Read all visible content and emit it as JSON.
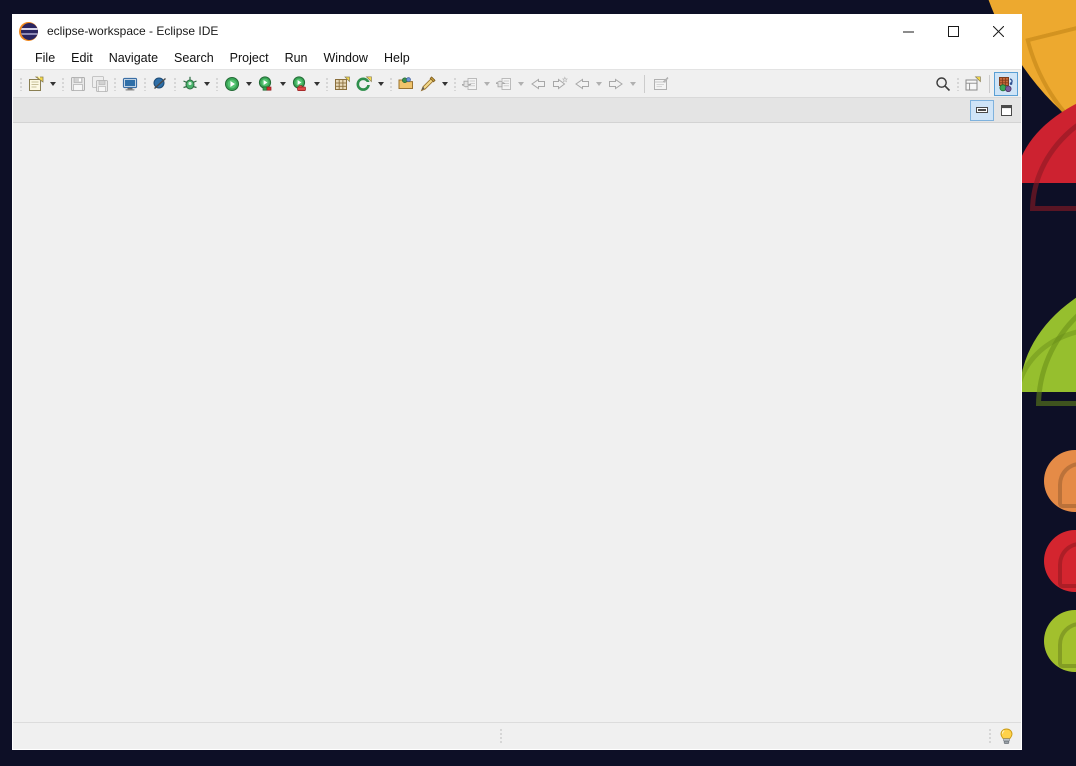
{
  "desktop": {
    "name": "desktop-wallpaper",
    "background_color": "#0d0f26",
    "shapes": [
      {
        "name": "petal-orange",
        "color": "#eda92f"
      },
      {
        "name": "petal-red",
        "color": "#cd2230"
      },
      {
        "name": "petal-green",
        "color": "#96bf2e"
      },
      {
        "name": "badge-orange",
        "color": "#e58b47"
      },
      {
        "name": "badge-red",
        "color": "#d4252f"
      },
      {
        "name": "badge-green",
        "color": "#a2c02d"
      }
    ]
  },
  "window": {
    "title": "eclipse-workspace - Eclipse IDE",
    "app_icon": "eclipse-logo-icon",
    "controls": [
      {
        "name": "minimize",
        "icon": "minimize-icon"
      },
      {
        "name": "maximize",
        "icon": "maximize-icon"
      },
      {
        "name": "close",
        "icon": "close-icon"
      }
    ]
  },
  "menubar": {
    "items": [
      {
        "label": "File"
      },
      {
        "label": "Edit"
      },
      {
        "label": "Navigate"
      },
      {
        "label": "Search"
      },
      {
        "label": "Project"
      },
      {
        "label": "Run"
      },
      {
        "label": "Window"
      },
      {
        "label": "Help"
      }
    ]
  },
  "toolbar": {
    "new_label": "New",
    "new_dropdown_label": "New menu",
    "save_label": "Save",
    "save_all_label": "Save All",
    "console_label": "Open Console",
    "skip_breakpoints_label": "Skip All Breakpoints",
    "debug_label": "Debug",
    "debug_dropdown_label": "Debug menu",
    "run_label": "Run",
    "run_dropdown_label": "Run menu",
    "coverage_label": "Coverage",
    "coverage_dropdown_label": "Coverage menu",
    "profile_label": "Profile",
    "profile_dropdown_label": "Profile menu",
    "new_package_label": "New Java Package",
    "new_class_label": "New Java Class",
    "new_class_dropdown_label": "New Java Class menu",
    "open_type_label": "Open Type",
    "quickfix_label": "Toggle Mark Occurrences",
    "quickfix_dropdown_label": "Mark Occurrences menu",
    "next_annotation_label": "Next Annotation",
    "next_annotation_dropdown_label": "Next Annotation menu",
    "prev_annotation_label": "Previous Annotation",
    "prev_annotation_dropdown_label": "Previous Annotation menu",
    "last_edit_label": "Last Edit Location",
    "forward_edit_label": "Next Edit Location",
    "back_label": "Back",
    "back_dropdown_label": "Back history",
    "forward_label": "Forward",
    "forward_dropdown_label": "Forward history",
    "pin_editor_label": "Pin Editor",
    "search_label": "Search",
    "open_perspective_label": "Open Perspective",
    "java_perspective_label": "Java",
    "java_perspective_active": true,
    "accent_active_bg": "#cfe4f7",
    "accent_active_border": "#5a9fd4"
  },
  "editor": {
    "trim_buttons": [
      {
        "name": "restore",
        "label": "Restore",
        "active": true
      },
      {
        "name": "maximize",
        "label": "Maximize",
        "active": false
      }
    ],
    "content": ""
  },
  "statusbar": {
    "left_text": "",
    "right_text": "",
    "tip_icon_label": "Tip of the Day"
  }
}
